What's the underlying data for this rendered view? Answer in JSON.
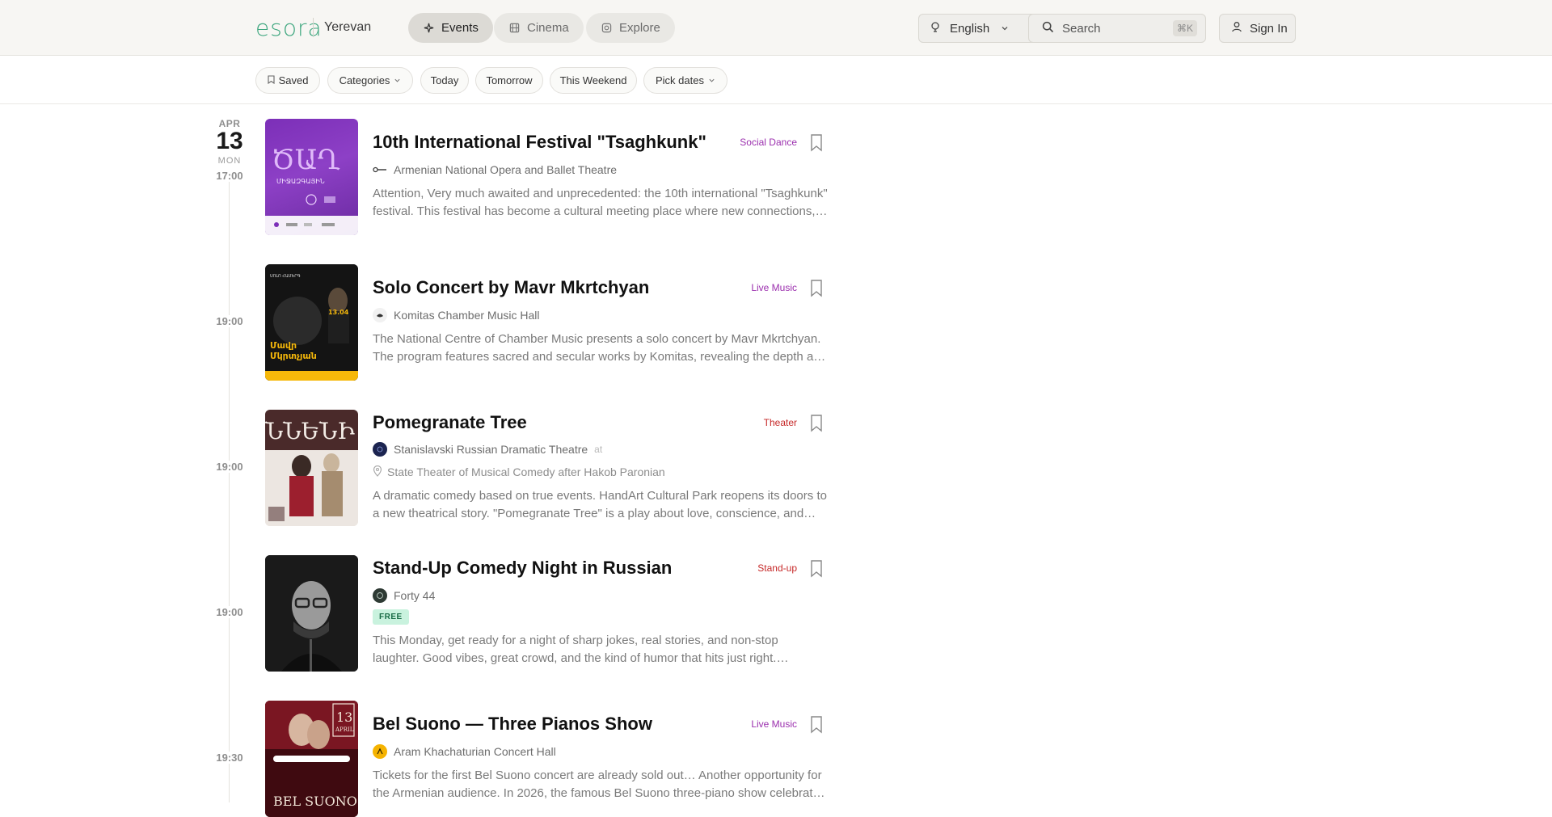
{
  "header": {
    "logo": "esora",
    "city": "Yerevan",
    "nav": [
      {
        "label": "Events",
        "icon": "sparkle-icon",
        "active": true
      },
      {
        "label": "Cinema",
        "icon": "film-icon",
        "active": false
      },
      {
        "label": "Explore",
        "icon": "compass-icon",
        "active": false
      }
    ],
    "language": "English",
    "search": {
      "placeholder": "Search",
      "shortcut": "⌘K"
    },
    "sign_in": "Sign In"
  },
  "filters": {
    "saved": "Saved",
    "categories": "Categories",
    "today": "Today",
    "tomorrow": "Tomorrow",
    "this_weekend": "This Weekend",
    "pick_dates": "Pick dates"
  },
  "date": {
    "month": "APR",
    "day": "13",
    "weekday": "MON"
  },
  "events": [
    {
      "time": "17:00",
      "title": "10th International Festival \"Tsaghkunk\"",
      "category": "Social Dance",
      "category_color": "#9b2fae",
      "venue": "Armenian National Opera and Ballet Theatre",
      "description": [
        "Attention, Very much awaited and unprecedented: the 10th international \"Tsaghkunk\"",
        "festival. This festival has become a cultural meeting place where new connections,…"
      ]
    },
    {
      "time": "19:00",
      "title": "Solo Concert by Mavr Mkrtchyan",
      "category": "Live Music",
      "category_color": "#9b2fae",
      "venue": "Komitas Chamber Music Hall",
      "description": [
        "The National Centre of Chamber Music presents a solo concert by Mavr Mkrtchyan.",
        "The program features sacred and secular works by Komitas, revealing the depth a…"
      ]
    },
    {
      "time": "19:00",
      "title": "Pomegranate Tree",
      "category": "Theater",
      "category_color": "#c62828",
      "venue": "Stanislavski Russian Dramatic Theatre",
      "venue_suffix": "at",
      "location": "State Theater of Musical Comedy after Hakob Paronian",
      "description": [
        "A dramatic comedy based on true events. HandArt Cultural Park reopens its doors to",
        "a new theatrical story. \"Pomegranate Tree\" is a play about love, conscience, and…"
      ]
    },
    {
      "time": "19:00",
      "title": "Stand-Up Comedy Night in Russian",
      "category": "Stand-up",
      "category_color": "#c62828",
      "venue": "Forty 44",
      "badge": "FREE",
      "description": [
        "This Monday, get ready for a night of sharp jokes, real stories, and non-stop",
        "laughter. Good vibes, great crowd, and the kind of humor that hits just right.…"
      ]
    },
    {
      "time": "19:30",
      "title": "Bel Suono — Three Pianos Show",
      "category": "Live Music",
      "category_color": "#9b2fae",
      "venue": "Aram Khachaturian Concert Hall",
      "description": [
        "Tickets for the first Bel Suono concert are already sold out… Another opportunity for",
        "the Armenian audience. In 2026, the famous Bel Suono three-piano show celebrat…"
      ]
    }
  ]
}
